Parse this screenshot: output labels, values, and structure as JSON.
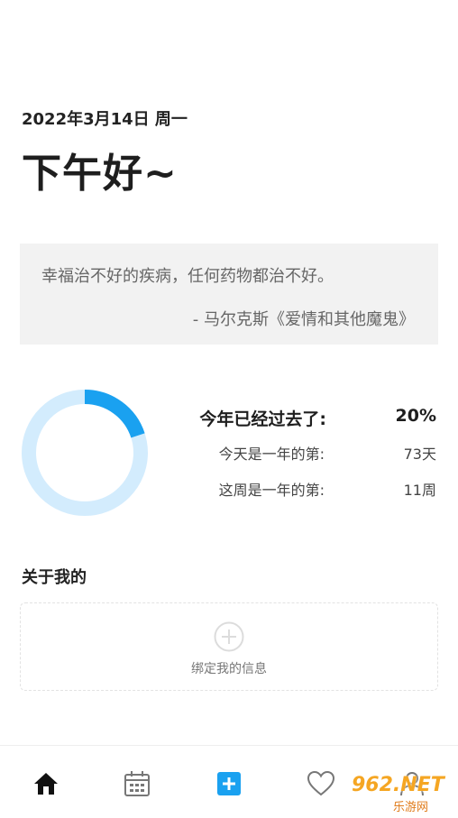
{
  "header": {
    "date": "2022年3月14日 周一",
    "greeting": "下午好~"
  },
  "quote": {
    "text": "幸福治不好的疾病，任何药物都治不好。",
    "source": "- 马尔克斯《爱情和其他魔鬼》"
  },
  "progress": {
    "year_fraction": 0.2,
    "ring_colors": {
      "fill": "#1aa1f0",
      "track": "#d3ecfd"
    },
    "rows": [
      {
        "label": "今年已经过去了:",
        "value": "20%"
      },
      {
        "label": "今天是一年的第:",
        "value": "73天"
      },
      {
        "label": "这周是一年的第:",
        "value": "11周"
      }
    ]
  },
  "about": {
    "title": "关于我的",
    "bind_label": "绑定我的信息"
  },
  "tabbar": {
    "items": [
      {
        "name": "home",
        "icon": "home-icon",
        "active": true
      },
      {
        "name": "calendar",
        "icon": "calendar-icon",
        "active": false
      },
      {
        "name": "add",
        "icon": "add-icon",
        "active": false
      },
      {
        "name": "favorites",
        "icon": "heart-icon",
        "active": false
      },
      {
        "name": "profile",
        "icon": "user-icon",
        "active": false
      }
    ],
    "accent": "#1aa1f0"
  },
  "watermark": {
    "brand": "962.NET",
    "sub": "乐游网"
  }
}
